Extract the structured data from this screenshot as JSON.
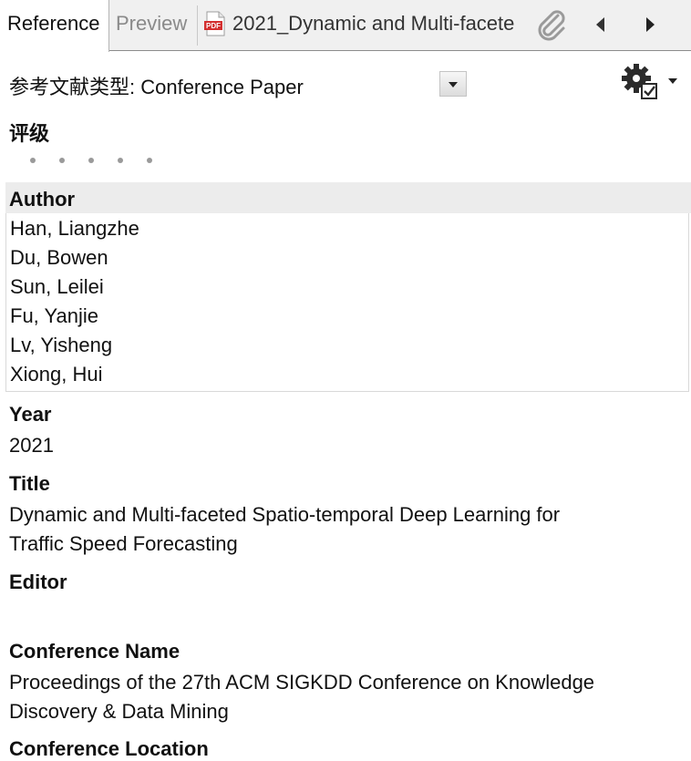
{
  "tabs": {
    "reference": "Reference",
    "preview": "Preview",
    "file": "2021_Dynamic and Multi-facete",
    "pdf_icon_text": "PDF"
  },
  "reference_type": {
    "label": "参考文献类型: Conference Paper"
  },
  "rating": {
    "label": "评级",
    "stars": 0,
    "max": 5
  },
  "fields": {
    "author_label": "Author",
    "authors": [
      "Han, Liangzhe",
      "Du, Bowen",
      "Sun, Leilei",
      "Fu, Yanjie",
      "Lv, Yisheng",
      "Xiong, Hui"
    ],
    "year_label": "Year",
    "year": "2021",
    "title_label": "Title",
    "title_line1": "Dynamic and Multi-faceted Spatio-temporal Deep Learning for",
    "title_line2": "Traffic Speed Forecasting",
    "editor_label": "Editor",
    "editor": "",
    "conference_name_label": "Conference Name",
    "conference_name_line1": "Proceedings of the 27th ACM SIGKDD Conference on Knowledge",
    "conference_name_line2": "Discovery & Data Mining",
    "conference_location_label": "Conference Location"
  },
  "icons": {
    "pdf": "pdf-file-icon",
    "attachment": "paperclip-icon",
    "nav_prev": "triangle-left-icon",
    "nav_next": "triangle-right-icon",
    "settings": "gear-checkbox-icon",
    "pdf_color": "#d32f2f"
  }
}
